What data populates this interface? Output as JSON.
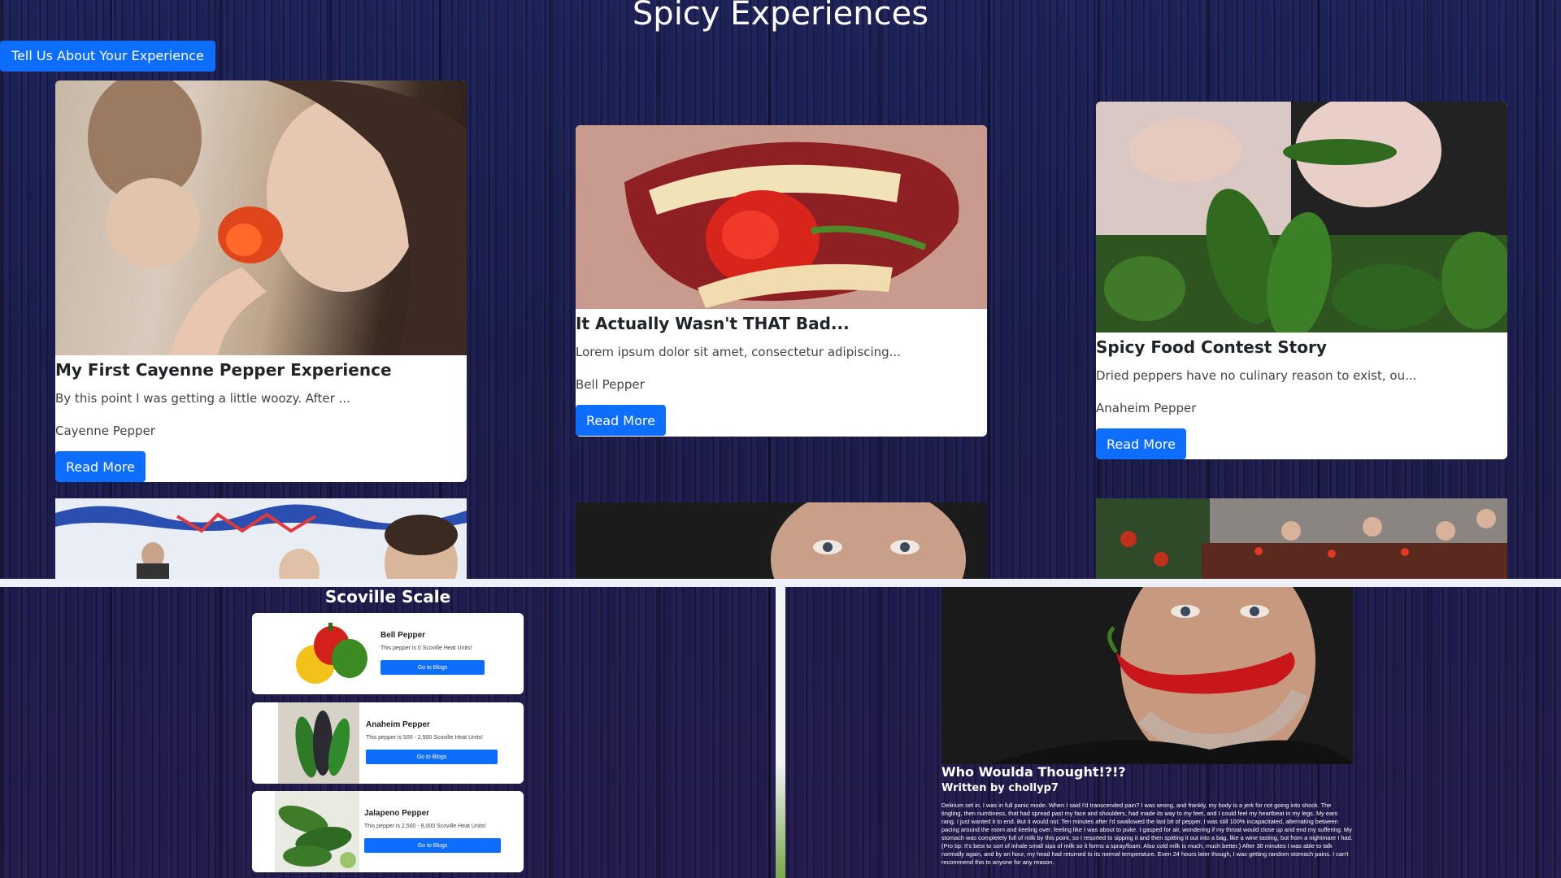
{
  "header": {
    "title": "Spicy Experiences",
    "cta_label": "Tell Us About Your Experience"
  },
  "cards": [
    {
      "title": "My First Cayenne Pepper Experience",
      "excerpt": "By this point I was getting a little woozy. After ...",
      "pepper": "Cayenne Pepper",
      "button": "Read More"
    },
    {
      "title": "It Actually Wasn't THAT Bad...",
      "excerpt": "Lorem ipsum dolor sit amet, consectetur adipiscing...",
      "pepper": "Bell Pepper",
      "button": "Read More"
    },
    {
      "title": "Spicy Food Contest Story",
      "excerpt": "Dried peppers have no culinary reason to exist, ou...",
      "pepper": "Anaheim Pepper",
      "button": "Read More"
    }
  ],
  "scoville": {
    "title": "Scoville Scale",
    "items": [
      {
        "name": "Bell Pepper",
        "desc": "This pepper is 0 Scoville Heat Units!",
        "button": "Go to Blogs"
      },
      {
        "name": "Anaheim Pepper",
        "desc": "This pepper is 500 - 2,500 Scoville Heat Units!",
        "button": "Go to Blogs"
      },
      {
        "name": "Jalapeno Pepper",
        "desc": "This pepper is 2,500 - 8,000 Scoville Heat Units!",
        "button": "Go to Blogs"
      }
    ]
  },
  "blog": {
    "title": "Who Woulda Thought!?!?",
    "author": "Written by chollyp7",
    "body": "Delirium set in. I was in full panic mode. When I said I'd transcended pain? I was wrong, and frankly, my body is a jerk for not going into shock. The tingling, then numbness, that had spread past my face and shoulders, had made its way to my feet, and I could feel my heartbeat in my legs. My ears rang. I just wanted it to end. But it would not. Ten minutes after I'd swallowed the last bit of pepper, I was still 100% incapacitated, alternating between pacing around the room and keeling over, feeling like I was about to puke. I gasped for air, wondering if my throat would close up and end my suffering. My stomach was completely full of milk by this point, so I resorted to sipping it and then spitting it out into a bag, like a wine tasting, but from a nightmare I had. (Pro tip: It's best to sort of inhale small sips of milk so it forms a spray/foam. Also cold milk is much, much better.) After 30 minutes I was able to talk normally again, and by an hour, my head had returned to its normal temperature. Even 24 hours later though, I was getting random stomach pains. I can't recommend this to anyone for any reason."
  }
}
